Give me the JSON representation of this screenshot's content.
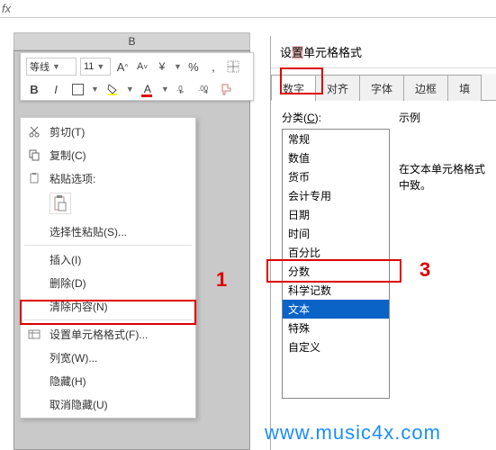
{
  "formula_bar": {
    "fx": "fx"
  },
  "column": {
    "letter": "B"
  },
  "mini_toolbar": {
    "font_name": "等线",
    "font_size": "11",
    "increase_font": "A^",
    "decrease_font": "A˅",
    "currency": "¥",
    "percent": "%",
    "comma": ",",
    "bold": "B",
    "italic": "I",
    "font_color": "A"
  },
  "context_menu": {
    "cut": "剪切(T)",
    "copy": "复制(C)",
    "paste_options": "粘贴选项:",
    "paste_icon": "📋",
    "paste_special": "选择性粘贴(S)...",
    "insert": "插入(I)",
    "delete": "删除(D)",
    "clear": "清除内容(N)",
    "format_cells": "设置单元格格式(F)...",
    "column_width": "列宽(W)...",
    "hide": "隐藏(H)",
    "unhide": "取消隐藏(U)"
  },
  "markers": {
    "one": "1",
    "three": "3"
  },
  "dialog": {
    "title_pre": "设",
    "title_mid": "置",
    "title_post": "单元格格式",
    "tabs": {
      "number": "数字",
      "alignment": "对齐",
      "font": "字体",
      "border": "边框",
      "fill": "填"
    },
    "category_label": "分类(C):",
    "categories": [
      "常规",
      "数值",
      "货币",
      "会计专用",
      "日期",
      "时间",
      "百分比",
      "分数",
      "科学记数",
      "文本",
      "特殊",
      "自定义"
    ],
    "selected_category": "文本",
    "sample_label": "示例",
    "description": "在文本单元格格式中致。"
  },
  "watermark": "www.music4x.com"
}
